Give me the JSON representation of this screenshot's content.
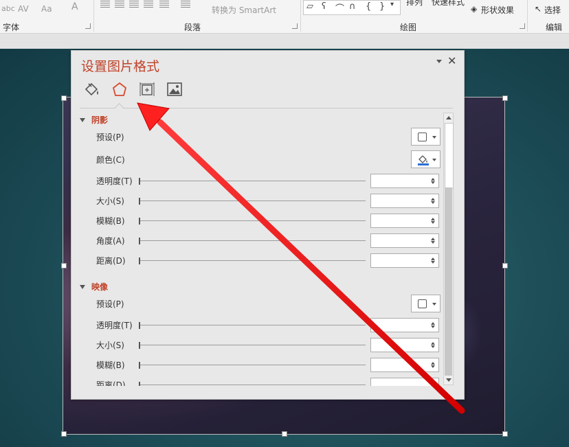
{
  "ribbon": {
    "groups": {
      "font": "字体",
      "paragraph": "段落",
      "drawing": "绘图",
      "editing": "编辑"
    },
    "font_row": {
      "abc": "abc",
      "spacing": "AV",
      "case": "Aa",
      "color": "A"
    },
    "smartart_label": "转换为 SmartArt",
    "arrange_label": "排列",
    "quick_styles_label": "快速样式",
    "shape_effects_label": "形状效果",
    "select_label": "选择"
  },
  "pane": {
    "title": "设置图片格式",
    "tabs": [
      {
        "name": "fill-line",
        "icon": "paint-bucket-icon"
      },
      {
        "name": "effects",
        "icon": "pentagon-icon",
        "active": true
      },
      {
        "name": "size-properties",
        "icon": "size-icon"
      },
      {
        "name": "picture",
        "icon": "picture-icon"
      }
    ],
    "shadow": {
      "heading": "阴影",
      "preset": "预设(P)",
      "color": "颜色(C)",
      "transparency": "透明度(T)",
      "size": "大小(S)",
      "blur": "模糊(B)",
      "angle": "角度(A)",
      "distance": "距离(D)"
    },
    "reflection": {
      "heading": "映像",
      "preset": "预设(P)",
      "transparency": "透明度(T)",
      "size": "大小(S)",
      "blur": "模糊(B)",
      "distance": "距离(D)"
    }
  },
  "colors": {
    "accent": "#c0432a",
    "arrow": "#ff1a1a"
  }
}
